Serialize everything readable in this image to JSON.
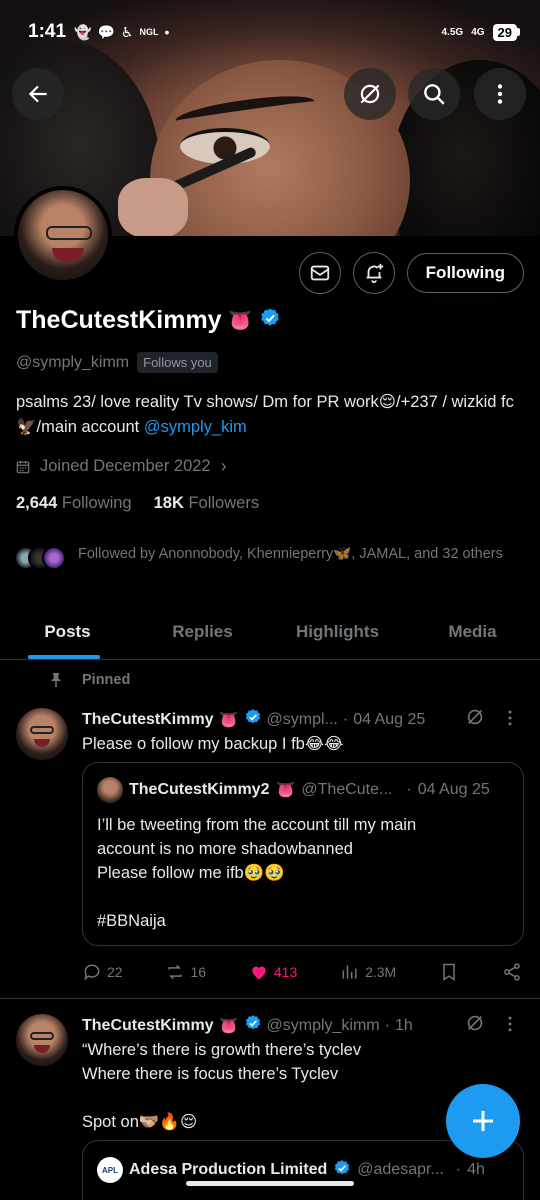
{
  "status_bar": {
    "time": "1:41",
    "notif_icons": [
      "snapchat-icon",
      "chat-icon",
      "accessibility-icon",
      "ngl-icon"
    ],
    "ngl_label": "NGL",
    "dot": "•",
    "network1": "4.5G",
    "network2": "4G",
    "battery": "29"
  },
  "profile": {
    "name": "TheCutestKimmy",
    "name_emoji": "👅",
    "handle": "@symply_kimm",
    "follows_you": "Follows you",
    "bio_text": "psalms 23/ love reality Tv shows/ Dm for PR work😌/+237 / wizkid fc 🦅/main account ",
    "bio_link": "@symply_kim",
    "joined": "Joined December 2022",
    "following_count": "2,644",
    "following_label": "Following",
    "followers_count": "18K",
    "followers_label": "Followers",
    "followed_by": "Followed by Anonnobody, Khennieperry🦋, JAMAL, and 32 others",
    "follow_button": "Following"
  },
  "tabs": [
    {
      "label": "Posts",
      "active": true
    },
    {
      "label": "Replies",
      "active": false
    },
    {
      "label": "Highlights",
      "active": false
    },
    {
      "label": "Media",
      "active": false
    }
  ],
  "pinned_label": "Pinned",
  "posts": [
    {
      "name": "TheCutestKimmy",
      "emoji": "👅",
      "handle": "@sympl...",
      "sep": "·",
      "date": "04 Aug 25",
      "text": "Please o follow my backup I fb😂😂",
      "quote": {
        "name": "TheCutestKimmy2",
        "emoji": "👅",
        "handle": "@TheCute...",
        "sep": "·",
        "date": "04 Aug 25",
        "lines": [
          "I’ll be tweeting from the account till my main",
          "account is no more shadowbanned",
          "Please follow me ifb🥹🥹",
          "",
          "#BBNaija"
        ]
      },
      "replies": "22",
      "reposts": "16",
      "likes": "413",
      "views": "2.3M"
    },
    {
      "name": "TheCutestKimmy",
      "emoji": "👅",
      "handle": "@symply_kimm",
      "sep": "·",
      "date": "1h",
      "lines": [
        "“Where’s there is growth there’s tyclev",
        "Where there is focus there’s Tyclev",
        "",
        "Spot on🫱🏼‍🫲🏽🔥😌"
      ],
      "quote": {
        "logo": "APL",
        "name": "Adesa Production Limited",
        "handle": "@adesapr...",
        "sep": "·",
        "date": "4h"
      }
    }
  ],
  "colors": {
    "accent": "#1d9bf0",
    "like": "#f91880",
    "background": "#000000",
    "muted": "#71767b"
  }
}
